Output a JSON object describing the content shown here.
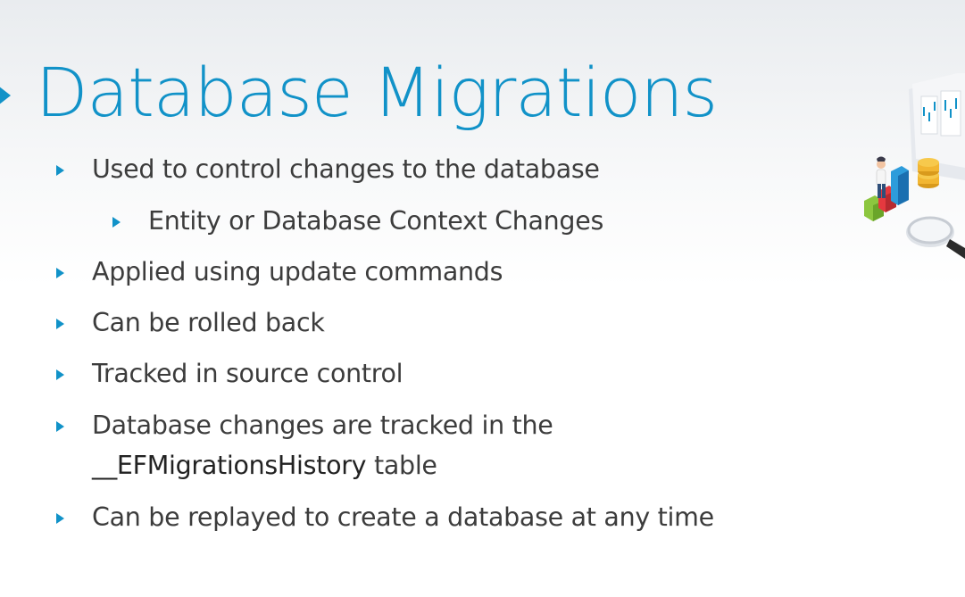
{
  "slide": {
    "title": "Database Migrations",
    "bullets": [
      "Used to control changes to the database",
      "Entity or Database Context Changes",
      "Applied using update commands",
      "Can be rolled back",
      "Tracked in source control",
      "Database changes are tracked in the",
      "__EFMigrationsHistory",
      "table",
      "Can be replayed to create a database at any time"
    ]
  },
  "colors": {
    "accent": "#1192c8",
    "text": "#3c3c3c",
    "background": "#ffffff"
  },
  "icons": {
    "title_marker": "triangle-right-icon",
    "bullet_marker": "triangle-right-icon",
    "illustration": "data-analytics-illustration"
  }
}
